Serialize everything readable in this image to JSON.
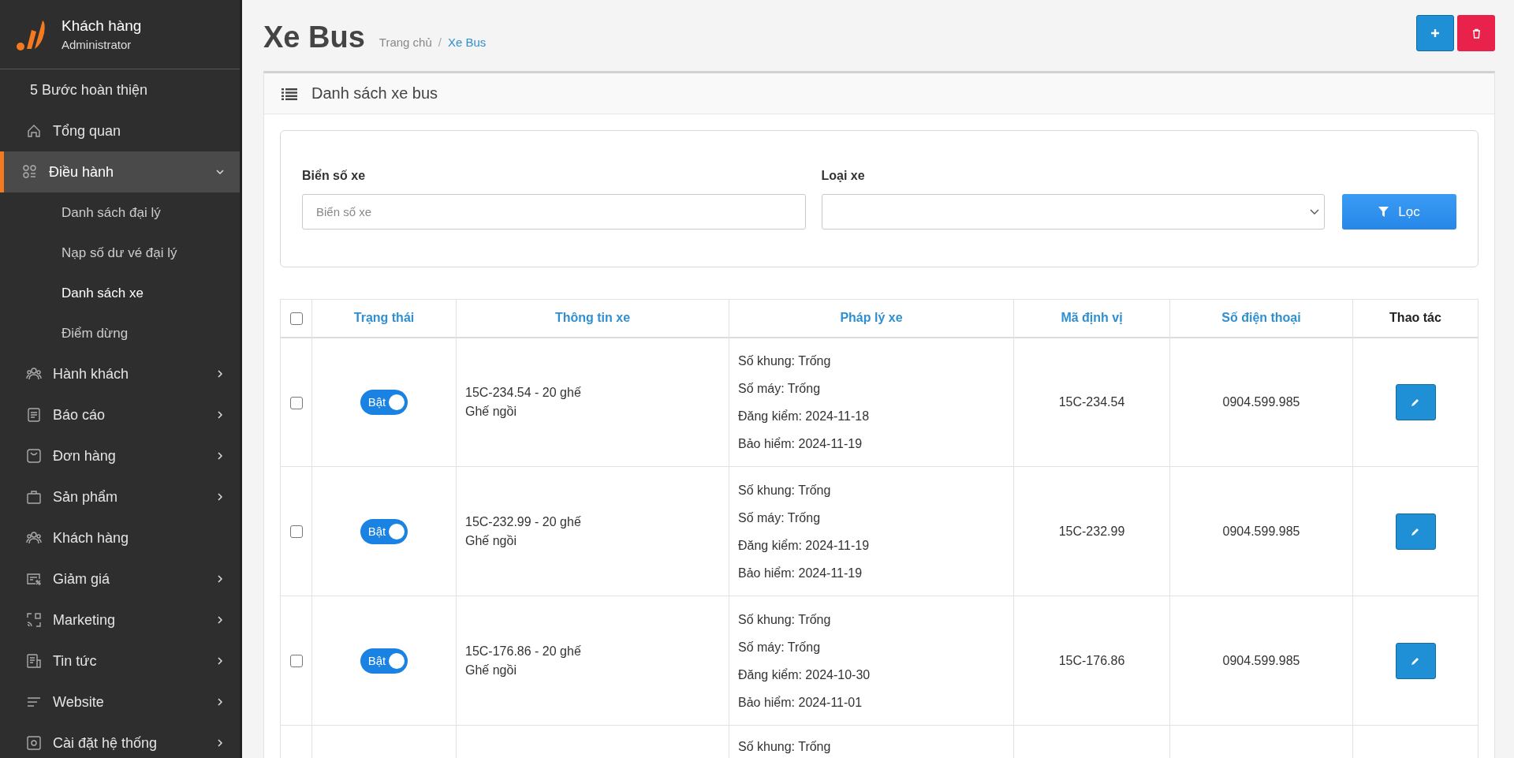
{
  "brand": {
    "title": "Khách hàng",
    "subtitle": "Administrator"
  },
  "sidebar": {
    "items": [
      {
        "label": "5 Bước hoàn thiện",
        "kind": "plain",
        "selected": false
      },
      {
        "label": "Tổng quan",
        "kind": "link",
        "selected": false
      },
      {
        "label": "Điều hành",
        "kind": "menu",
        "selected": true,
        "expanded": true,
        "children": [
          {
            "label": "Danh sách đại lý",
            "selected": false
          },
          {
            "label": "Nạp số dư vé đại lý",
            "selected": false
          },
          {
            "label": "Danh sách xe",
            "selected": true
          },
          {
            "label": "Điểm dừng",
            "selected": false
          }
        ]
      },
      {
        "label": "Hành khách",
        "kind": "menu",
        "selected": false,
        "expanded": false
      },
      {
        "label": "Báo cáo",
        "kind": "menu",
        "selected": false,
        "expanded": false
      },
      {
        "label": "Đơn hàng",
        "kind": "menu",
        "selected": false,
        "expanded": false
      },
      {
        "label": "Sản phẩm",
        "kind": "menu",
        "selected": false,
        "expanded": false
      },
      {
        "label": "Khách hàng",
        "kind": "link",
        "selected": false
      },
      {
        "label": "Giảm giá",
        "kind": "menu",
        "selected": false,
        "expanded": false
      },
      {
        "label": "Marketing",
        "kind": "menu",
        "selected": false,
        "expanded": false
      },
      {
        "label": "Tin tức",
        "kind": "menu",
        "selected": false,
        "expanded": false
      },
      {
        "label": "Website",
        "kind": "menu",
        "selected": false,
        "expanded": false
      },
      {
        "label": "Cài đặt hệ thống",
        "kind": "menu",
        "selected": false,
        "expanded": false
      }
    ]
  },
  "page": {
    "title": "Xe Bus",
    "breadcrumb_separator": "/",
    "breadcrumb": [
      {
        "label": "Trang chủ",
        "current": false
      },
      {
        "label": "Xe Bus",
        "current": true
      }
    ]
  },
  "card": {
    "title": "Danh sách xe bus"
  },
  "filter": {
    "plate": {
      "label": "Biển số xe",
      "placeholder": "Biển số xe"
    },
    "type": {
      "label": "Loại xe"
    },
    "button": "Lọc"
  },
  "table": {
    "select_all": {
      "checked": false
    },
    "columns": [
      {
        "label": "Trạng thái",
        "sortable": true
      },
      {
        "label": "Thông tin xe",
        "sortable": true
      },
      {
        "label": "Pháp lý xe",
        "sortable": true
      },
      {
        "label": "Mã định vị",
        "sortable": true
      },
      {
        "label": "Số điện thoại",
        "sortable": true
      },
      {
        "label": "Thao tác",
        "sortable": false
      }
    ],
    "rows": [
      {
        "checked": false,
        "status": {
          "label": "Bật",
          "on": true
        },
        "info": [
          "15C-234.54 - 20 ghế",
          "Ghế ngồi"
        ],
        "legal": [
          "Số khung: Trống",
          "Số máy: Trống",
          "Đăng kiểm: 2024-11-18",
          "Bảo hiểm: 2024-11-19"
        ],
        "tracker": "15C-234.54",
        "phone": "0904.599.985"
      },
      {
        "checked": false,
        "status": {
          "label": "Bật",
          "on": true
        },
        "info": [
          "15C-232.99 - 20 ghế",
          "Ghế ngồi"
        ],
        "legal": [
          "Số khung: Trống",
          "Số máy: Trống",
          "Đăng kiểm: 2024-11-19",
          "Bảo hiểm: 2024-11-19"
        ],
        "tracker": "15C-232.99",
        "phone": "0904.599.985"
      },
      {
        "checked": false,
        "status": {
          "label": "Bật",
          "on": true
        },
        "info": [
          "15C-176.86 - 20 ghế",
          "Ghế ngồi"
        ],
        "legal": [
          "Số khung: Trống",
          "Số máy: Trống",
          "Đăng kiểm: 2024-10-30",
          "Bảo hiểm: 2024-11-01"
        ],
        "tracker": "15C-176.86",
        "phone": "0904.599.985"
      },
      {
        "legal": [
          "Số khung: Trống"
        ]
      }
    ]
  }
}
